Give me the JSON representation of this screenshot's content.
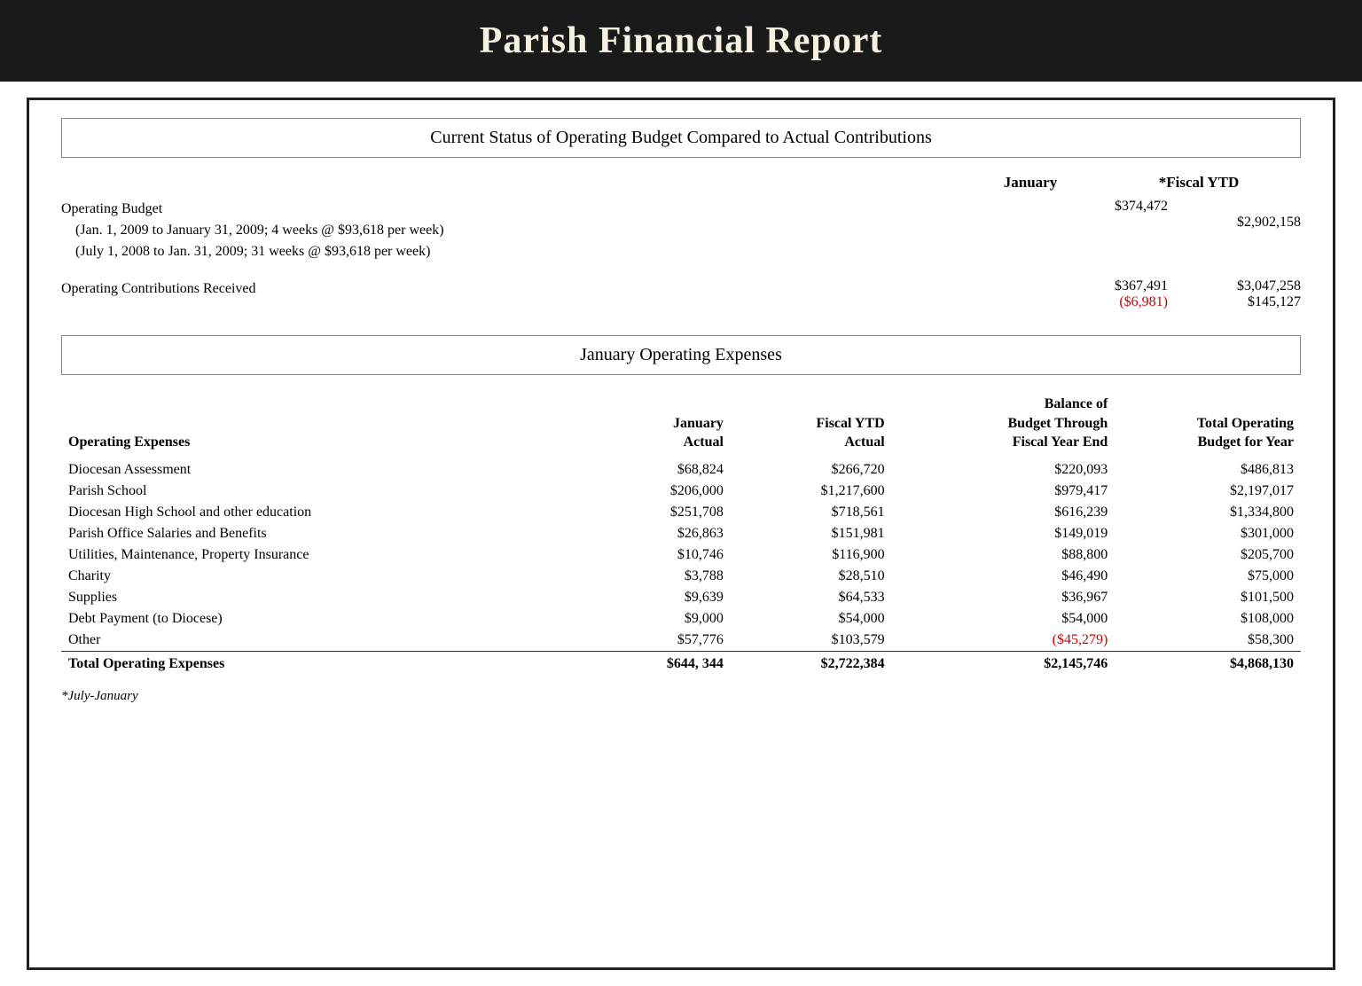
{
  "header": {
    "title": "Parish Financial Report"
  },
  "operating_budget_section": {
    "box_title": "Current Status of Operating Budget Compared to Actual Contributions",
    "col_january": "January",
    "col_ytd": "*Fiscal YTD",
    "rows": [
      {
        "label": "Operating Budget",
        "sub1": "(Jan. 1, 2009 to January 31, 2009; 4 weeks @ $93,618 per week)",
        "sub2": "(July 1, 2008 to Jan. 31, 2009; 31 weeks @ $93,618 per week)",
        "jan_val": "$374,472",
        "jan_val2": "",
        "ytd_val": "",
        "ytd_val2": "$2,902,158"
      },
      {
        "label": "Operating Contributions Received",
        "sub1": "",
        "sub2": "",
        "jan_val": "$367,491",
        "jan_val2": "($6,981)",
        "ytd_val": "$3,047,258",
        "ytd_val2": "$145,127"
      }
    ]
  },
  "expenses_section": {
    "box_title": "January Operating Expenses",
    "col_label": "Operating Expenses",
    "col_jan": "January\nActual",
    "col_ytd": "Fiscal YTD\nActual",
    "col_balance": "Balance of\nBudget Through\nFiscal Year End",
    "col_total": "Total Operating\nBudget for Year",
    "rows": [
      {
        "label": "Diocesan Assessment",
        "jan": "$68,824",
        "ytd": "$266,720",
        "balance": "$220,093",
        "total": "$486,813",
        "red_balance": false
      },
      {
        "label": "Parish School",
        "jan": "$206,000",
        "ytd": "$1,217,600",
        "balance": "$979,417",
        "total": "$2,197,017",
        "red_balance": false
      },
      {
        "label": "Diocesan High School and other education",
        "jan": "$251,708",
        "ytd": "$718,561",
        "balance": "$616,239",
        "total": "$1,334,800",
        "red_balance": false
      },
      {
        "label": "Parish Office Salaries and Benefits",
        "jan": "$26,863",
        "ytd": "$151,981",
        "balance": "$149,019",
        "total": "$301,000",
        "red_balance": false
      },
      {
        "label": "Utilities, Maintenance, Property Insurance",
        "jan": "$10,746",
        "ytd": "$116,900",
        "balance": "$88,800",
        "total": "$205,700",
        "red_balance": false
      },
      {
        "label": "Charity",
        "jan": "$3,788",
        "ytd": "$28,510",
        "balance": "$46,490",
        "total": "$75,000",
        "red_balance": false
      },
      {
        "label": "Supplies",
        "jan": "$9,639",
        "ytd": "$64,533",
        "balance": "$36,967",
        "total": "$101,500",
        "red_balance": false
      },
      {
        "label": "Debt Payment (to Diocese)",
        "jan": "$9,000",
        "ytd": "$54,000",
        "balance": "$54,000",
        "total": "$108,000",
        "red_balance": false
      },
      {
        "label": "Other",
        "jan": "$57,776",
        "ytd": "$103,579",
        "balance": "($45,279)",
        "total": "$58,300",
        "red_balance": true
      }
    ],
    "total_row": {
      "label": "Total Operating Expenses",
      "jan": "$644, 344",
      "ytd": "$2,722,384",
      "balance": "$2,145,746",
      "total": "$4,868,130"
    },
    "footnote": "*July-January"
  }
}
